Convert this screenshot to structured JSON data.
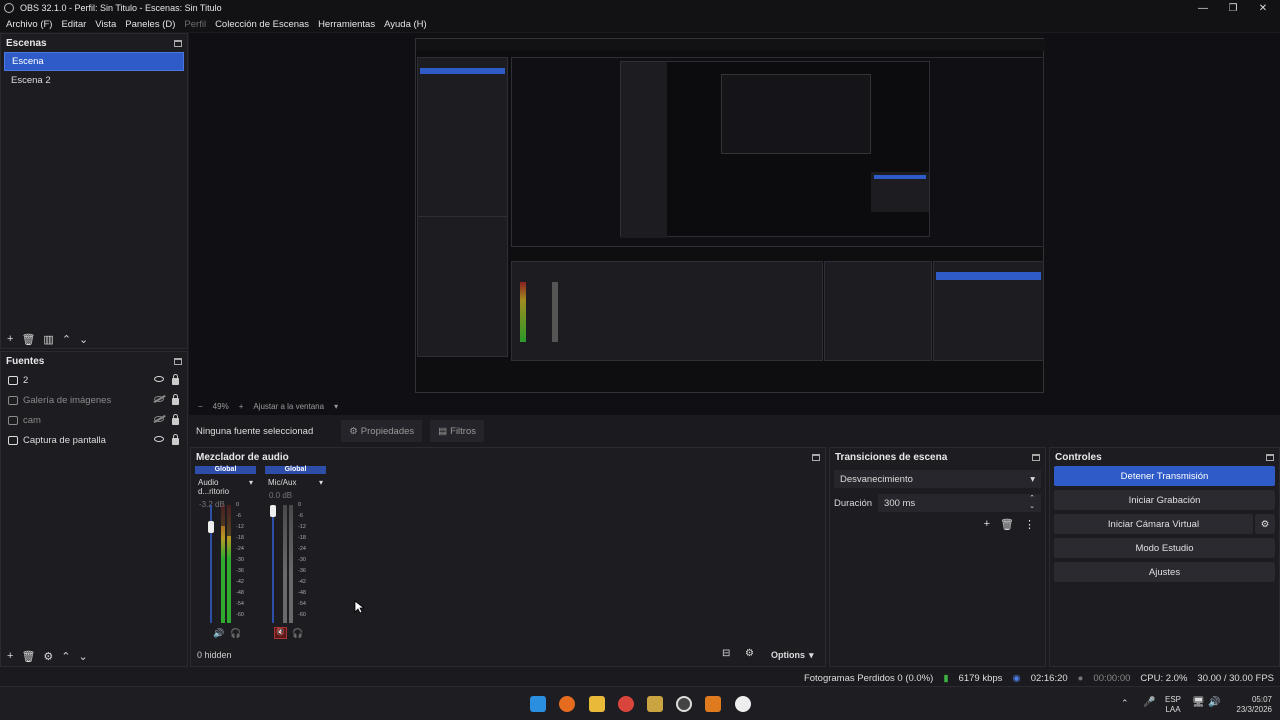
{
  "window": {
    "title": "OBS 32.1.0 - Perfil: Sin Titulo - Escenas: Sin Titulo"
  },
  "menu": [
    "Archivo (F)",
    "Editar",
    "Vista",
    "Paneles (D)",
    "Perfil",
    "Colección de Escenas",
    "Herramientas",
    "Ayuda (H)"
  ],
  "scenes": {
    "title": "Escenas",
    "items": [
      "Escena",
      "Escena 2"
    ]
  },
  "sources": {
    "title": "Fuentes",
    "items": [
      {
        "label": "2",
        "visible": true
      },
      {
        "label": "Galería de imágenes",
        "visible": false
      },
      {
        "label": "cam",
        "visible": false
      },
      {
        "label": "Captura de pantalla",
        "visible": true
      }
    ]
  },
  "preview_toolbar": {
    "zoom": "49%",
    "fit": "Ajustar a la ventana"
  },
  "props_bar": {
    "status": "Ninguna fuente seleccionad",
    "properties": "Propiedades",
    "filters": "Filtros"
  },
  "mixer": {
    "title": "Mezclador de audio",
    "channels": [
      {
        "header": "Global",
        "name": "Audio d...ritorio",
        "db": "-3.2 dB",
        "level": 0.82
      },
      {
        "header": "Global",
        "name": "Mic/Aux",
        "db": "0.0 dB",
        "level": 0.0
      }
    ],
    "scale": [
      "0",
      "-6",
      "-12",
      "-18",
      "-24",
      "-30",
      "-36",
      "-42",
      "-48",
      "-54",
      "-60"
    ],
    "hidden": "0 hidden",
    "options": "Options"
  },
  "transitions": {
    "title": "Transiciones de escena",
    "selected": "Desvanecimiento",
    "duration_label": "Duración",
    "duration": "300 ms"
  },
  "controls": {
    "title": "Controles",
    "buttons": [
      "Detener Transmisión",
      "Iniciar Grabación",
      "Iniciar Cámara Virtual",
      "Modo Estudio",
      "Ajustes"
    ]
  },
  "status": {
    "dropped": "Fotogramas Perdidos 0 (0.0%)",
    "bitrate": "6179 kbps",
    "stream_time": "02:16:20",
    "rec_time": "00:00:00",
    "cpu": "CPU: 2.0%",
    "fps": "30.00 / 30.00 FPS"
  },
  "taskbar": {
    "lang": "ESP",
    "region": "LAA",
    "time": "05:07",
    "date": "23/3/2026"
  },
  "colors": {
    "accent": "#2e5bc8",
    "bg": "#1b1b1f",
    "panel": "#1c1c21"
  }
}
